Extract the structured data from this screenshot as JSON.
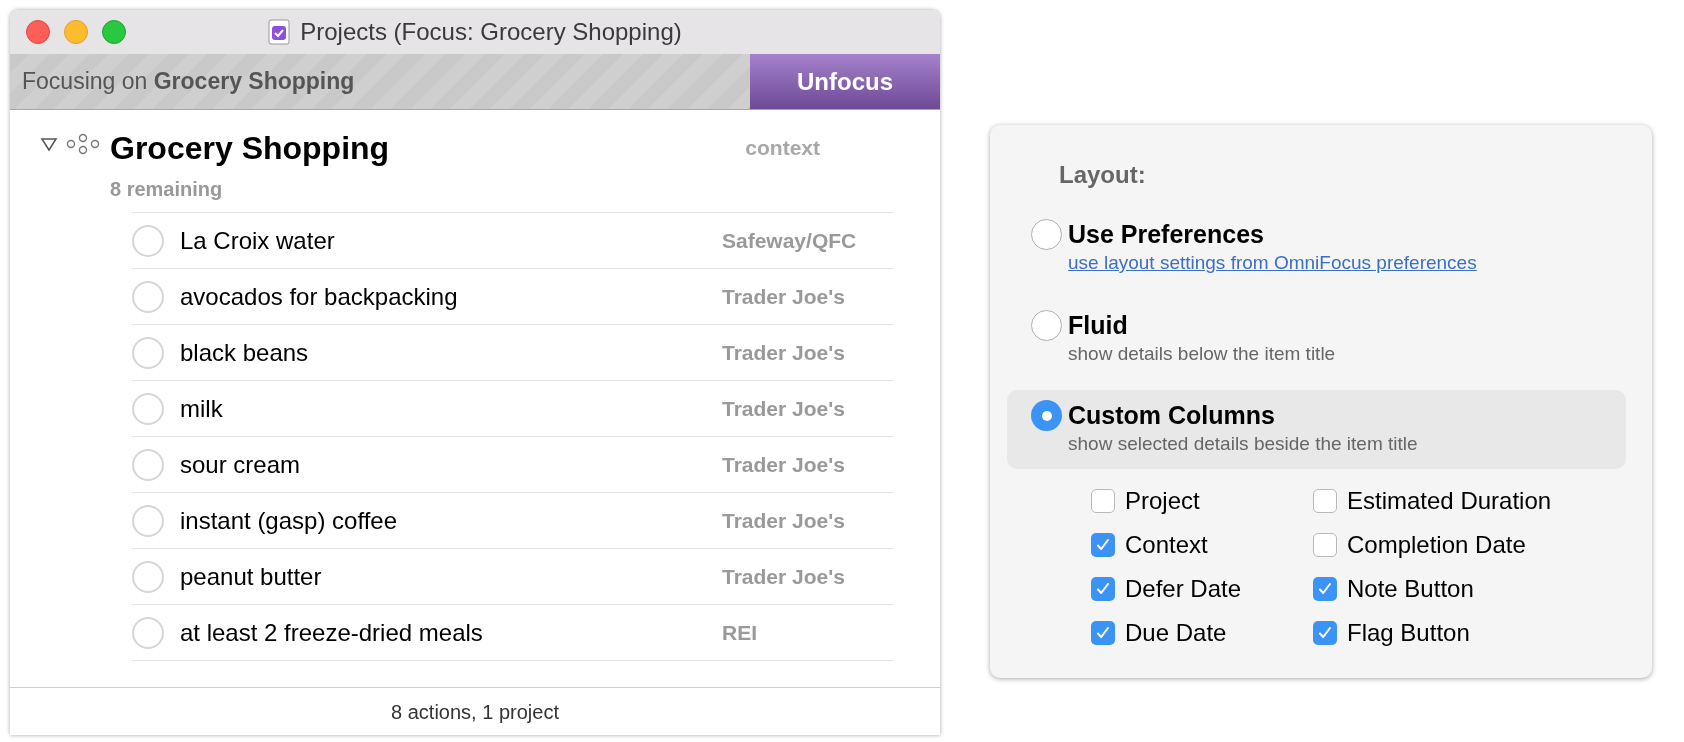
{
  "window": {
    "title": "Projects (Focus: Grocery Shopping)"
  },
  "focus_bar": {
    "text": "Focusing on **Grocery Shopping**",
    "button": "Unfocus"
  },
  "project": {
    "title": "Grocery Shopping",
    "remaining": "8 remaining",
    "column_header": "context",
    "expanded": true,
    "actions": [
      {
        "title": "La Croix water",
        "context": "Safeway/QFC",
        "checked": false
      },
      {
        "title": "avocados for backpacking",
        "context": "Trader Joe's",
        "checked": false
      },
      {
        "title": "black beans",
        "context": "Trader Joe's",
        "checked": false
      },
      {
        "title": "milk",
        "context": "Trader Joe's",
        "checked": false
      },
      {
        "title": "sour cream",
        "context": "Trader Joe's",
        "checked": false
      },
      {
        "title": "instant (gasp) coffee",
        "context": "Trader Joe's",
        "checked": false
      },
      {
        "title": "peanut butter",
        "context": "Trader Joe's",
        "checked": false
      },
      {
        "title": "at least 2 freeze-dried meals",
        "context": "REI",
        "checked": false
      }
    ]
  },
  "status_bar": "8 actions, 1 project",
  "layout_panel": {
    "heading": "Layout:",
    "options": [
      {
        "label": "Use Preferences",
        "detail": "use layout settings from OmniFocus preferences",
        "kind": "link",
        "selected": false
      },
      {
        "label": "Fluid",
        "detail": "show details below the item title",
        "kind": "text",
        "selected": false
      },
      {
        "label": "Custom Columns",
        "detail": "show selected details beside the item title",
        "kind": "text",
        "selected": true
      }
    ],
    "columns": [
      {
        "label": "Project",
        "checked": false
      },
      {
        "label": "Estimated Duration",
        "checked": false
      },
      {
        "label": "Context",
        "checked": true
      },
      {
        "label": "Completion Date",
        "checked": false
      },
      {
        "label": "Defer Date",
        "checked": true
      },
      {
        "label": "Note Button",
        "checked": true
      },
      {
        "label": "Due Date",
        "checked": true
      },
      {
        "label": "Flag Button",
        "checked": true
      }
    ]
  }
}
